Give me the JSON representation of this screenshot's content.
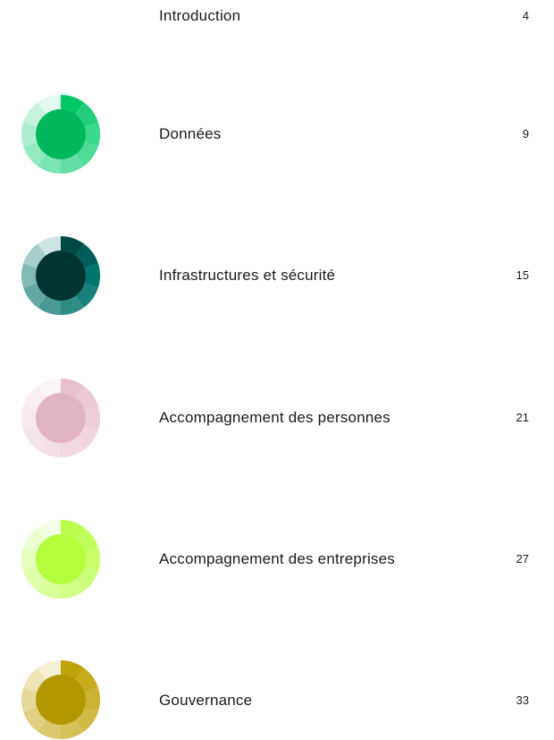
{
  "toc": {
    "entries": [
      {
        "title": "Introduction",
        "page": "4",
        "has_emblem": false
      },
      {
        "title": "Données",
        "page": "9",
        "has_emblem": true,
        "icon": "donnees-emblem-icon",
        "colors": {
          "core": "#00b75d",
          "segments": [
            "#00c768",
            "#23cf7d",
            "#38d98c",
            "#4edb97",
            "#64dea6",
            "#7ae4b2",
            "#93e9c0",
            "#aeeed0",
            "#c7f3de",
            "#e1f9ee"
          ]
        }
      },
      {
        "title": "Infrastructures et sécurité",
        "page": "15",
        "has_emblem": true,
        "icon": "infrastructures-emblem-icon",
        "colors": {
          "core": "#003532",
          "segments": [
            "#004a45",
            "#005e58",
            "#00766e",
            "#168079",
            "#2f8d86",
            "#499a94",
            "#63a8a3",
            "#82bab6",
            "#a6cfcc",
            "#cfe5e3"
          ]
        }
      },
      {
        "title": "Accompagnement des personnes",
        "page": "21",
        "has_emblem": true,
        "icon": "personnes-emblem-icon",
        "colors": {
          "core": "#e2b4c1",
          "segments": [
            "#e7c0cb",
            "#ebc9d3",
            "#eecfd8",
            "#f0d5dc",
            "#f1d9e0",
            "#f3dfe5",
            "#f5e4e9",
            "#f7eaee",
            "#f9eff2",
            "#fbf5f7"
          ]
        }
      },
      {
        "title": "Accompagnement des entreprises",
        "page": "27",
        "has_emblem": true,
        "icon": "entreprises-emblem-icon",
        "colors": {
          "core": "#b3ff3d",
          "segments": [
            "#b9ff4c",
            "#bfff59",
            "#c6ff68",
            "#ccff78",
            "#d2ff88",
            "#d8ff99",
            "#dfffaa",
            "#e6ffbd",
            "#edffd2",
            "#f5ffe6"
          ]
        }
      },
      {
        "title": "Gouvernance",
        "page": "33",
        "has_emblem": true,
        "icon": "gouvernance-emblem-icon",
        "colors": {
          "core": "#b39700",
          "segments": [
            "#bfa30b",
            "#c6ab1c",
            "#cbb230",
            "#d0b944",
            "#d5c059",
            "#dbc86e",
            "#e0d084",
            "#e6d99c",
            "#ede4b7",
            "#f5efd6"
          ]
        }
      }
    ]
  }
}
